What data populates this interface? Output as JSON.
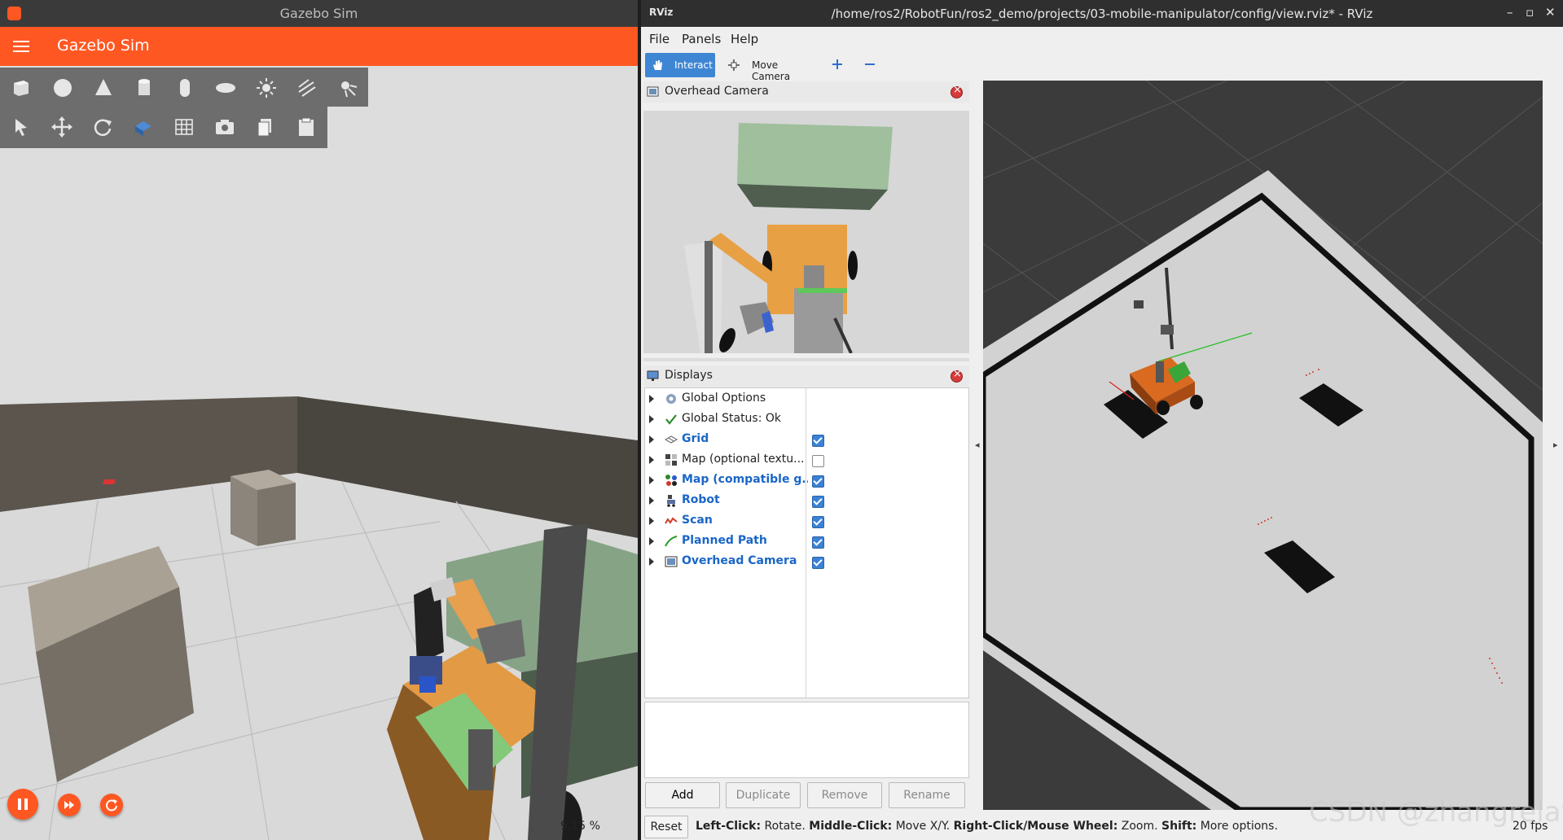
{
  "gazebo": {
    "window_title": "Gazebo Sim",
    "app_title": "Gazebo Sim",
    "shape_tools": [
      "box-icon",
      "sphere-icon",
      "cone-icon",
      "cylinder-icon",
      "capsule-icon",
      "ellipsoid-icon",
      "sun-light-icon",
      "directional-light-icon",
      "spot-light-icon"
    ],
    "transform_tools": [
      "select-icon",
      "translate-icon",
      "rotate-icon",
      "snap-icon",
      "grid-icon",
      "screenshot-icon",
      "copy-icon",
      "paste-icon"
    ],
    "rtf": "9.15 %",
    "playback": {
      "pause": "pause-icon",
      "step": "step-forward-icon",
      "reset": "reset-icon"
    },
    "colors": {
      "accent": "#ff5722",
      "toolbar": "#6d6d6d"
    }
  },
  "rviz": {
    "window_title": "/home/ros2/RobotFun/ros2_demo/projects/03-mobile-manipulator/config/view.rviz* - RViz",
    "logo": "RViz",
    "menu": [
      "File",
      "Panels",
      "Help"
    ],
    "toolbar": {
      "interact": "Interact",
      "move_camera": "Move Camera"
    },
    "camera_panel": {
      "title": "Overhead Camera"
    },
    "displays_panel": {
      "title": "Displays",
      "items": [
        {
          "label": "Global Options",
          "icon": "gear-icon",
          "checked": null
        },
        {
          "label": "Global Status: Ok",
          "icon": "check-icon",
          "checked": null
        },
        {
          "label": "Grid",
          "icon": "grid-icon",
          "checked": true
        },
        {
          "label": "Map (optional textu...",
          "icon": "map-icon",
          "checked": false
        },
        {
          "label": "Map (compatible g...",
          "icon": "map-color-icon",
          "checked": true
        },
        {
          "label": "Robot",
          "icon": "robot-icon",
          "checked": true
        },
        {
          "label": "Scan",
          "icon": "scan-icon",
          "checked": true
        },
        {
          "label": "Planned Path",
          "icon": "path-icon",
          "checked": true
        },
        {
          "label": "Overhead Camera",
          "icon": "camera-icon",
          "checked": true
        }
      ]
    },
    "buttons": {
      "add": "Add",
      "duplicate": "Duplicate",
      "remove": "Remove",
      "rename": "Rename"
    },
    "status": {
      "reset": "Reset",
      "lc_key": "Left-Click:",
      "lc_val": " Rotate.",
      "mc_key": "Middle-Click:",
      "mc_val": " Move X/Y.",
      "rc_key": "Right-Click/Mouse Wheel:",
      "rc_val": " Zoom.",
      "sh_key": "Shift:",
      "sh_val": " More options.",
      "fps": "20 fps"
    },
    "watermark": "CSDN @zhangrelay"
  }
}
